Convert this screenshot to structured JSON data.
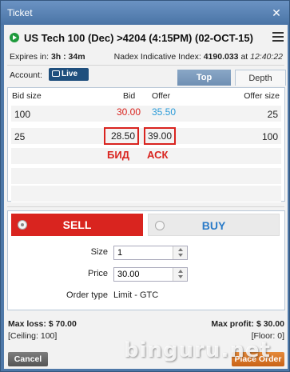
{
  "window": {
    "title": "Ticket",
    "close_icon": "close-icon"
  },
  "market": {
    "title": "US Tech 100 (Dec) >4204 (4:15PM) (02-OCT-15)",
    "expires_label": "Expires in:",
    "expires_value": "3h : 34m",
    "index_label": "Nadex Indicative Index:",
    "index_value": "4190.033",
    "index_at": "at",
    "index_time": "12:40:22"
  },
  "account": {
    "label": "Account:",
    "badge": "Live"
  },
  "tabs": [
    {
      "label": "Top"
    },
    {
      "label": "Depth"
    }
  ],
  "depth": {
    "headers": {
      "bid_size": "Bid size",
      "bid": "Bid",
      "offer": "Offer",
      "offer_size": "Offer size"
    },
    "rows": [
      {
        "bid_size": "100",
        "bid": "30.00",
        "offer": "35.50",
        "offer_size": "25"
      },
      {
        "bid_size": "25",
        "bid": "28.50",
        "offer": "39.00",
        "offer_size": "100"
      }
    ],
    "annotation_bid": "БИД",
    "annotation_ask": "АСК"
  },
  "trade": {
    "sell_label": "SELL",
    "buy_label": "BUY",
    "size_label": "Size",
    "size_value": "1",
    "price_label": "Price",
    "price_value": "30.00",
    "order_type_label": "Order type",
    "order_type_value": "Limit - GTC"
  },
  "summary": {
    "max_loss": "Max loss: $ 70.00",
    "max_profit": "Max profit: $ 30.00",
    "ceiling": "[Ceiling: 100]",
    "floor": "[Floor: 0]"
  },
  "buttons": {
    "cancel": "Cancel",
    "place_order": "Place Order"
  },
  "watermark": "binguru.net",
  "colors": {
    "bid_red": "#d9241f",
    "offer_blue": "#2a9bd8",
    "sell_red": "#d9241f",
    "place_orange": "#e07a2a"
  }
}
